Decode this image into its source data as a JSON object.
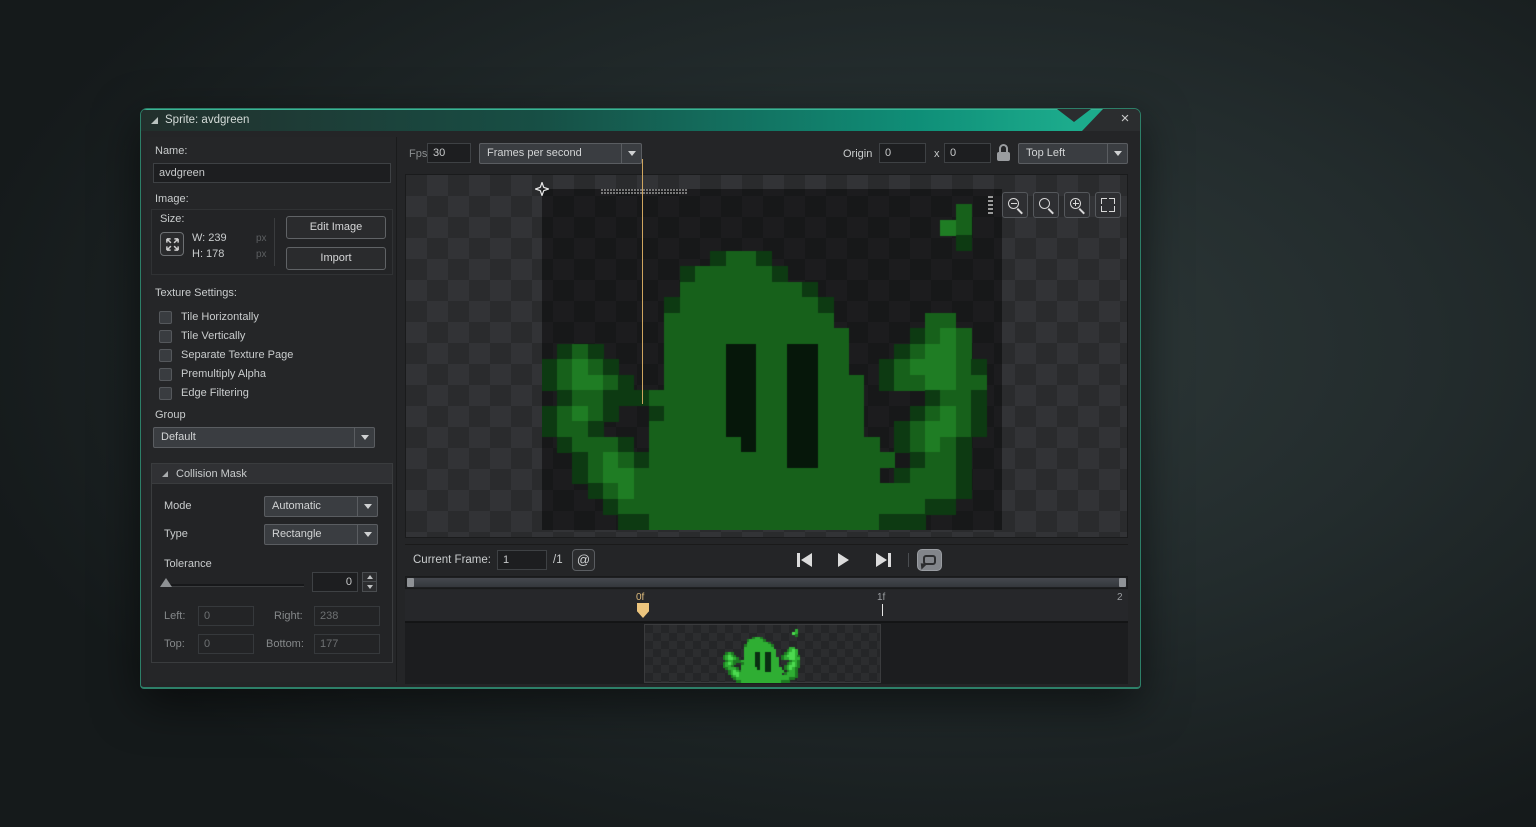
{
  "window": {
    "title": "Sprite: avdgreen"
  },
  "left_panel": {
    "name_label": "Name:",
    "name_value": "avdgreen",
    "image_label": "Image:",
    "size_label": "Size:",
    "width_value": "W: 239",
    "height_value": "H: 178",
    "px_unit": "px",
    "edit_image_button": "Edit Image",
    "import_button": "Import",
    "texture_settings_label": "Texture Settings:",
    "checkboxes": [
      "Tile Horizontally",
      "Tile Vertically",
      "Separate Texture Page",
      "Premultiply Alpha",
      "Edge Filtering"
    ],
    "group_label": "Group",
    "group_value": "Default",
    "collision": {
      "header": "Collision Mask",
      "mode_label": "Mode",
      "mode_value": "Automatic",
      "type_label": "Type",
      "type_value": "Rectangle",
      "tolerance_label": "Tolerance",
      "tolerance_value": "0",
      "left_label": "Left:",
      "left_value": "0",
      "right_label": "Right:",
      "right_value": "238",
      "top_label": "Top:",
      "top_value": "0",
      "bottom_label": "Bottom:",
      "bottom_value": "177"
    }
  },
  "toolbar": {
    "fps_label": "Fps",
    "fps_value": "30",
    "playback_mode_value": "Frames per second",
    "origin_label": "Origin",
    "origin_x_value": "0",
    "origin_separator": "x",
    "origin_y_value": "0",
    "origin_preset_value": "Top Left"
  },
  "controls": {
    "current_frame_label": "Current Frame:",
    "current_frame_value": "1",
    "frame_total": "/1",
    "onion_glyph": "@"
  },
  "timeline": {
    "tick_labels": [
      "0f",
      "1f",
      "2"
    ]
  },
  "colors": {
    "accent_teal": "#19ab8c",
    "playhead": "#ecc57e",
    "sprite_green": "#2fae33"
  },
  "close_glyph": "×",
  "sprite": {
    "pixels": [
      "..............................",
      "...........................g..",
      "..........................Gg..",
      "...........................d..",
      "...........dggd...............",
      ".........dgggggd..............",
      ".........ggggggggd............",
      "........dgggggggggd...........",
      "........ggggggggggg......gg...",
      "........gggggggggggg....dgGg..",
      ".dgd....ggggkkggkkgg...dgGGg..",
      "dgGgd...ggggkkggkkgg..dgGGGgd.",
      "dgGGgd..ggggkkggkkggg.dggGGgg.",
      ".dggdddgggggkkggkkggg....dggd.",
      "dgGgd..dggggkkggkkggg...dgGgd.",
      "dggd...gggggkkggkkggg..dgGGgd.",
      ".dgggd.ggggggkggkkgggg.dgGgd..",
      "..dgGgdgggggggggkkggggg.dggd..",
      "..dgGGgggggggggggggggg.dgggd..",
      "...dgGgggggggggggggggggggggd..",
      "....dggggggggggggggggggggdd...",
      ".....ddgggggggggggggggddd....."
    ],
    "palettes": {
      "canvas": {
        "g": "#17611b",
        "G": "#1f7d24",
        "d": "#0d3a12",
        "k": "#06170a"
      },
      "thumb": {
        "g": "#2fae33",
        "G": "#4cd94f",
        "d": "#1d7a22",
        "k": "#0a2e12"
      }
    }
  }
}
